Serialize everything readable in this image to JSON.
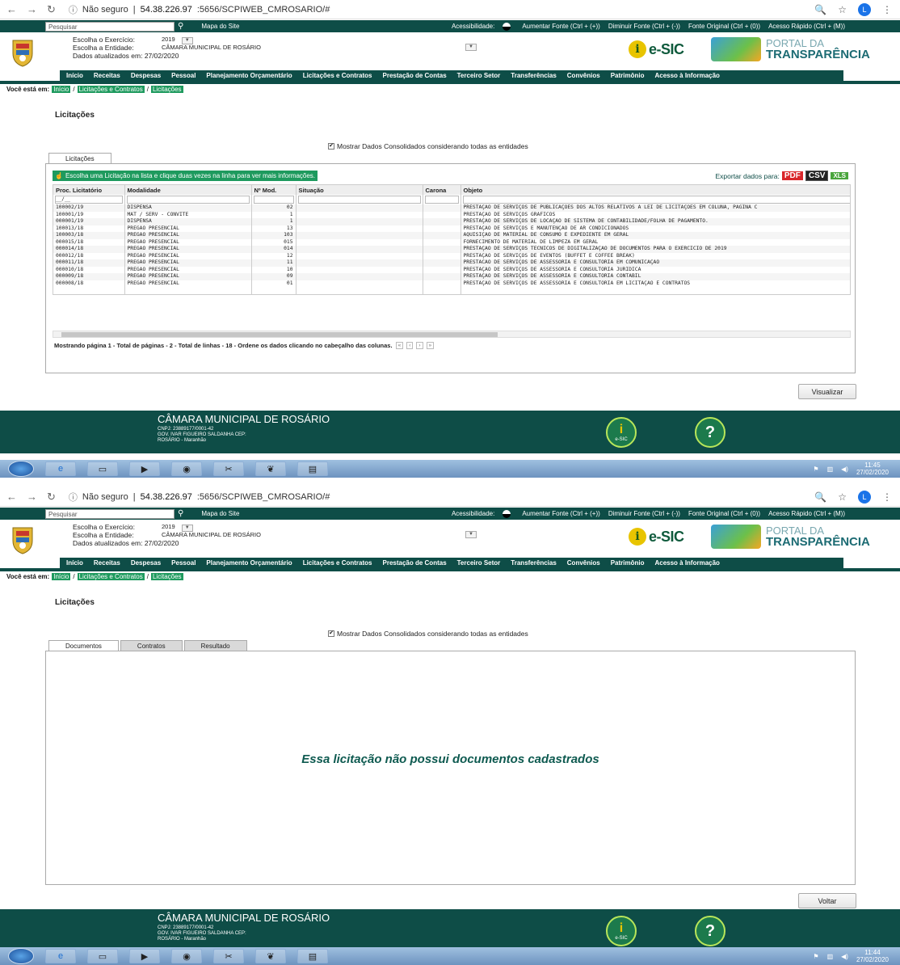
{
  "browser": {
    "security": "Não seguro",
    "host": "54.38.226.97",
    "rest": ":5656/SCPIWEB_CMROSARIO/#",
    "profile_initial": "L"
  },
  "topbar": {
    "search_placeholder": "Pesquisar",
    "sitemap": "Mapa do Site",
    "accessibility": "Acessibilidade:",
    "increase": "Aumentar Fonte (Ctrl + (+))",
    "decrease": "Diminuir Fonte (Ctrl + (-))",
    "original": "Fonte Original (Ctrl + (0))",
    "quick": "Acesso Rápido (Ctrl + (M))"
  },
  "header": {
    "exercise_label": "Escolha o Exercício:",
    "exercise_value": "2019",
    "entity_label": "Escolha a Entidade:",
    "entity_value": "CÂMARA MUNICIPAL DE ROSÁRIO",
    "updated": "Dados atualizados em: 27/02/2020",
    "esic": "e-SIC",
    "portal_1": "PORTAL DA",
    "portal_2": "TRANSPARÊNCIA"
  },
  "menu": [
    "Início",
    "Receitas",
    "Despesas",
    "Pessoal",
    "Planejamento Orçamentário",
    "Licitações e Contratos",
    "Prestação de Contas",
    "Terceiro Setor",
    "Transferências",
    "Convênios",
    "Patrimônio",
    "Acesso à Informação"
  ],
  "breadcrumb": {
    "prefix": "Você está em:",
    "items": [
      "Início",
      "Licitações e Contratos",
      "Licitações"
    ]
  },
  "page_title": "Licitações",
  "consolidated": "Mostrar Dados Consolidados considerando todas as entidades",
  "screen1": {
    "tab": "Licitações",
    "hint": "Escolha uma Licitação na lista e clique duas vezes na linha para ver mais informações.",
    "export_label": "Exportar dados para:",
    "export": [
      "PDF",
      "CSV",
      "XLS"
    ],
    "columns": [
      "Proc. Licitatório",
      "Modalidade",
      "Nº Mod.",
      "Situação",
      "Carona",
      "Objeto"
    ],
    "date_filter": "__/__",
    "rows": [
      [
        "100002/19",
        "DISPENSA",
        "02",
        "",
        "",
        "PRESTAÇÃO DE SERVIÇOS DE PUBLICAÇÕES DOS ALTOS RELATIVOS A LEI DE LICITAÇÕES EM COLUNA, PAGINA C"
      ],
      [
        "100001/19",
        "MAT / SERV - CONVITE",
        "1",
        "",
        "",
        "PRESTAÇÃO DE SERVIÇOS GRÁFICOS"
      ],
      [
        "000001/19",
        "DISPENSA",
        "1",
        "",
        "",
        "PRESTAÇÃO DE SERVIÇOS DE LOCAÇÃO DE SISTEMA DE CONTABILIDADE/FOLHA DE PAGAMENTO."
      ],
      [
        "100013/18",
        "PREGÃO PRESENCIAL",
        "13",
        "",
        "",
        "PRESTAÇÃO DE SERVIÇOS E MANUTENÇÃO DE AR CONDICIONADOS"
      ],
      [
        "100003/18",
        "PREGÃO PRESENCIAL",
        "103",
        "",
        "",
        "AQUISIÇÃO DE MATERIAL DE CONSUMO E EXPEDIENTE EM GERAL"
      ],
      [
        "000015/18",
        "PREGÃO PRESENCIAL",
        "015",
        "",
        "",
        "FORNECIMENTO DE MATERIAL DE LIMPEZA EM GERAL"
      ],
      [
        "000014/18",
        "PREGÃO PRESENCIAL",
        "014",
        "",
        "",
        "PRESTAÇÃO DE SERVIÇOS TÉCNICOS DE DIGITALIZAÇÃO DE DOCUMENTOS PARA O EXERCÍCIO DE 2019"
      ],
      [
        "000012/18",
        "PREGÃO PRESENCIAL",
        "12",
        "",
        "",
        "PRESTAÇÃO DE SERVIÇOS DE EVENTOS (BUFFET E COFFEE BREAK)"
      ],
      [
        "000011/18",
        "PREGÃO PRESENCIAL",
        "11",
        "",
        "",
        "PRESTACAO DE SERVIÇOS DE ASSESSORIA E CONSULTORIA EM COMUNICAÇÃO"
      ],
      [
        "000010/18",
        "PREGÃO PRESENCIAL",
        "10",
        "",
        "",
        "PRESTAÇÃO DE SERVIÇOS DE ASSESSORIA E CONSULTORIA JURÍDICA"
      ],
      [
        "000009/18",
        "PREGÃO PRESENCIAL",
        "09",
        "",
        "",
        "PRESTAÇÃO DE SERVIÇOS DE ASSESSORIA E CONSULTORIA CONTÁBIL"
      ],
      [
        "000008/18",
        "PREGÃO PRESENCIAL",
        "01",
        "",
        "",
        "PRESTAÇÃO DE SERVIÇOS DE ASSESSORIA E CONSULTORIA EM LICITAÇÃO E CONTRATOS"
      ]
    ],
    "pager": "Mostrando página 1 - Total de páginas - 2 - Total de linhas - 18 - Ordene os dados clicando no cabeçalho das colunas.",
    "pager_buttons": [
      "«",
      "‹",
      "›",
      "»"
    ],
    "button": "Visualizar",
    "clock_time": "11:45",
    "clock_date": "27/02/2020"
  },
  "screen2": {
    "tabs": [
      "Documentos",
      "Contratos",
      "Resultado"
    ],
    "empty": "Essa licitação não possui documentos cadastrados",
    "button": "Voltar",
    "clock_time": "11:44",
    "clock_date": "27/02/2020"
  },
  "footer": {
    "name": "CÂMARA MUNICIPAL DE ROSÁRIO",
    "cnpj": "CNPJ: 23889177/0001-42",
    "address": "GOV. IVAR FIGUEIRO SALDANHA CEP:",
    "city": "ROSÁRIO - Maranhão",
    "esic": "e-SIC"
  },
  "colors": {
    "brand": "#0e4d47",
    "link": "#1e9a5e",
    "pdf": "#d9262a",
    "xls": "#4aa53d"
  }
}
